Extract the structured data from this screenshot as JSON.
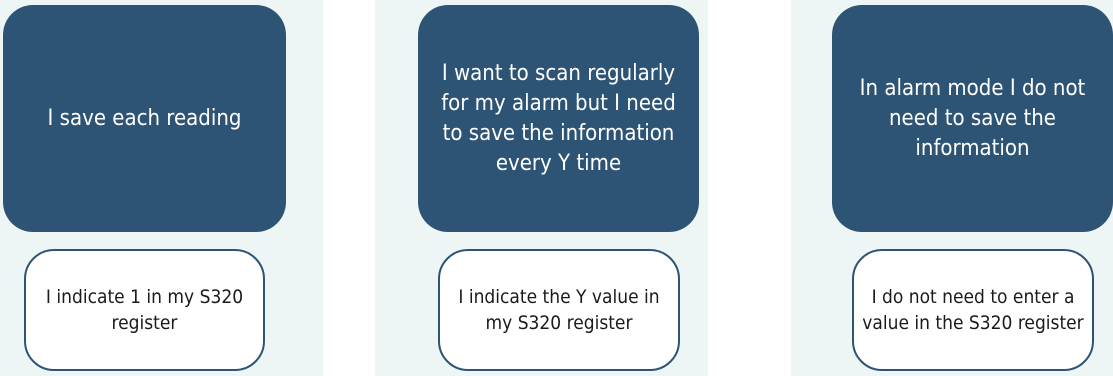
{
  "columns": [
    {
      "situation": "I save each reading",
      "action": "I indicate 1 in my S320 register"
    },
    {
      "situation": "I want to scan regularly for my alarm but I need to save the information every Y time",
      "action": "I indicate the Y value in my S320 register"
    },
    {
      "situation": "In alarm mode I do not need to save the information",
      "action": "I do not need to enter a value in the S320 register"
    }
  ],
  "colors": {
    "panel_background": "#eef5f5",
    "dark_box": "#2e5475",
    "light_box": "#ffffff"
  }
}
